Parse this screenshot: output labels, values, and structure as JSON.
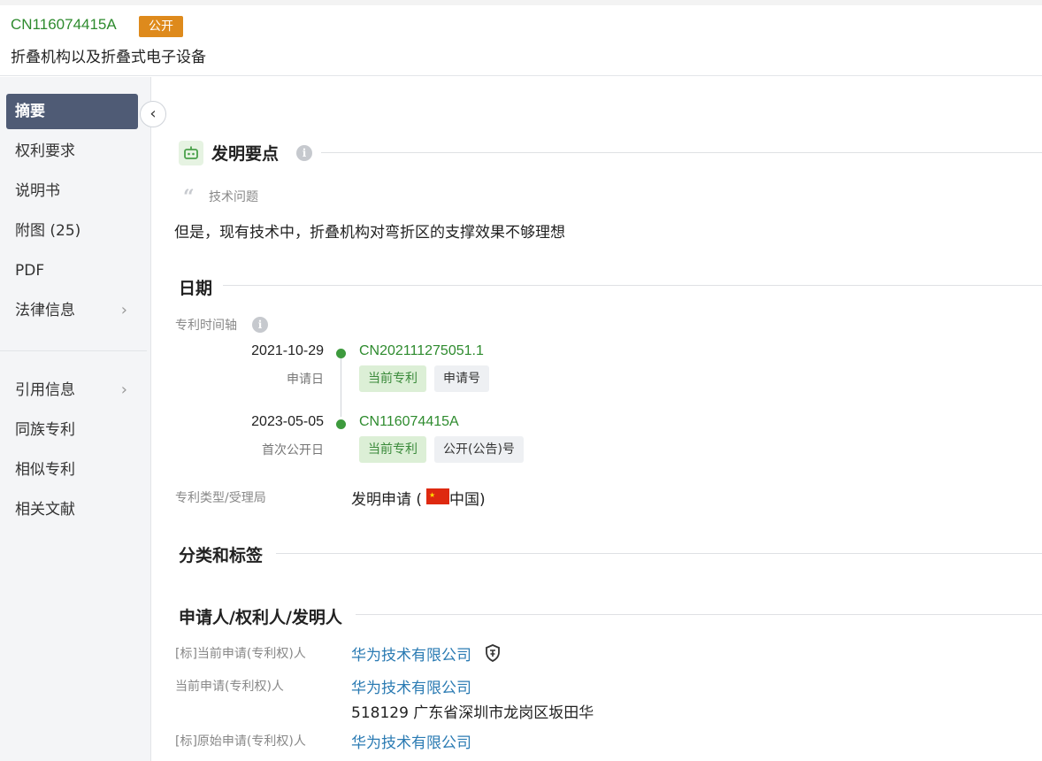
{
  "header": {
    "pub_number": "CN116074415A",
    "status_badge": "公开",
    "title": "折叠机构以及折叠式电子设备"
  },
  "sidebar": {
    "items": [
      {
        "label": "摘要",
        "active": true
      },
      {
        "label": "权利要求"
      },
      {
        "label": "说明书"
      },
      {
        "label": "附图 (25)"
      },
      {
        "label": "PDF"
      },
      {
        "label": "法律信息",
        "chevron": true
      },
      {
        "label": "引用信息",
        "chevron": true
      },
      {
        "label": "同族专利"
      },
      {
        "label": "相似专利"
      },
      {
        "label": "相关文献"
      }
    ],
    "chevron_glyph": "›",
    "collapse_glyph": "‹"
  },
  "invention": {
    "title": "发明要点",
    "info": "i",
    "tech_label": "技术问题",
    "tech_text": "但是，现有技术中，折叠机构对弯折区的支撑效果不够理想"
  },
  "dates": {
    "title": "日期",
    "timeline_label": "专利时间轴",
    "events": [
      {
        "date": "2021-10-29",
        "kind": "申请日",
        "number": "CN202111275051.1",
        "tag_current": "当前专利",
        "tag_type": "申请号"
      },
      {
        "date": "2023-05-05",
        "kind": "首次公开日",
        "number": "CN116074415A",
        "tag_current": "当前专利",
        "tag_type": "公开(公告)号"
      }
    ],
    "type_label": "专利类型/受理局",
    "type_value_prefix": "发明申请 (",
    "type_value_suffix": " 中国)"
  },
  "classification": {
    "title": "分类和标签"
  },
  "applicants": {
    "title": "申请人/权利人/发明人",
    "rows": [
      {
        "label": "[标]当前申请(专利权)人",
        "company": "华为技术有限公司"
      },
      {
        "label": "当前申请(专利权)人",
        "company": "华为技术有限公司",
        "address": "518129 广东省深圳市龙岗区坂田华"
      },
      {
        "label": "[标]原始申请(专利权)人",
        "company": "华为技术有限公司"
      }
    ]
  },
  "colors": {
    "accent_green": "#2e8b2e",
    "badge_orange": "#de8a1c",
    "nav_active": "#4f5b75",
    "link_blue": "#2b7bb3"
  }
}
